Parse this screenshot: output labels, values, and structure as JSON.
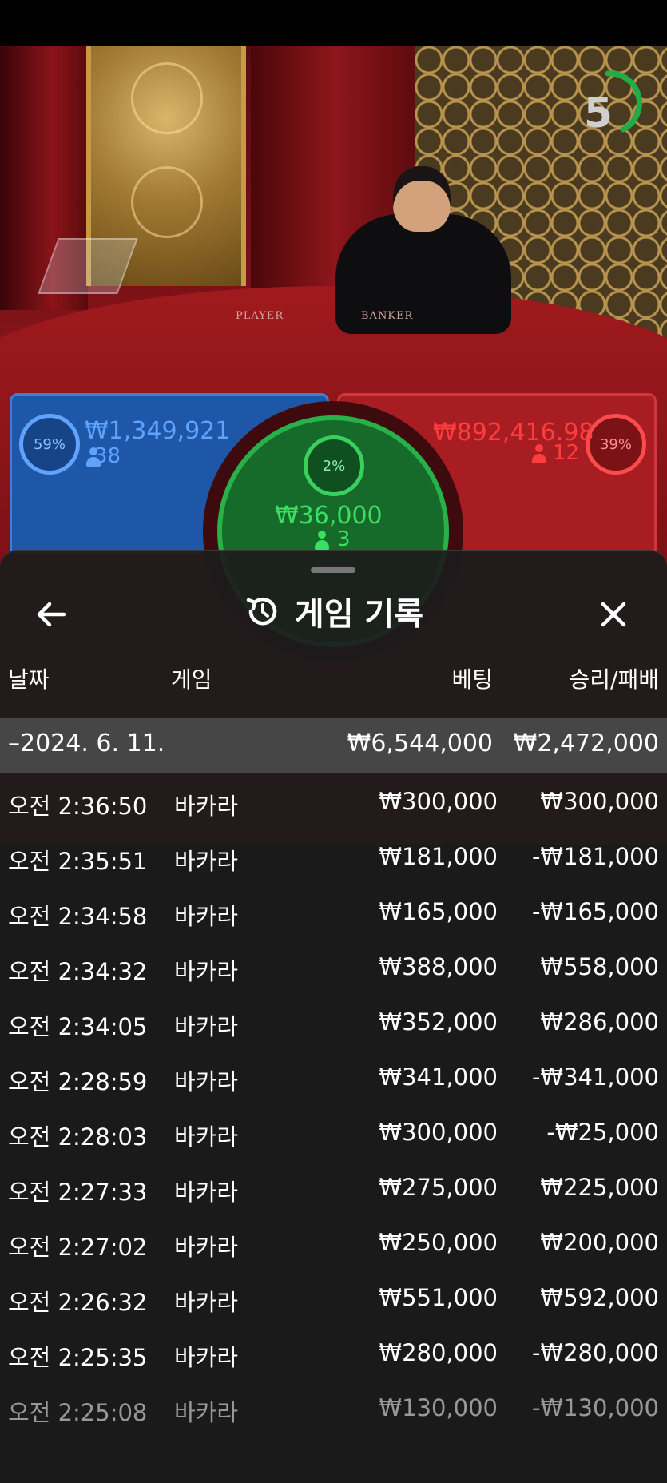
{
  "table": {
    "timer": "5",
    "player_label": "PLAYER",
    "banker_label": "BANKER",
    "player": {
      "percent": "59%",
      "amount": "₩1,349,921",
      "players": "38"
    },
    "banker": {
      "percent": "39%",
      "amount": "₩892,416.98",
      "players": "12"
    },
    "tie": {
      "percent": "2%",
      "amount": "₩36,000",
      "players": "3"
    }
  },
  "sheet": {
    "title": "게임 기록",
    "icons": {
      "back": "arrow-left-icon",
      "history": "history-icon",
      "close": "close-icon"
    },
    "columns": {
      "date": "날짜",
      "game": "게임",
      "bet": "베팅",
      "result": "승리/패배"
    },
    "date_group": {
      "label": "–2024. 6. 11.",
      "bet": "₩6,544,000",
      "result": "₩2,472,000"
    },
    "rows": [
      {
        "time": "오전 2:36:50",
        "game": "바카라",
        "bet": "₩300,000",
        "result": "₩300,000"
      },
      {
        "time": "오전 2:35:51",
        "game": "바카라",
        "bet": "₩181,000",
        "result": "-₩181,000"
      },
      {
        "time": "오전 2:34:58",
        "game": "바카라",
        "bet": "₩165,000",
        "result": "-₩165,000"
      },
      {
        "time": "오전 2:34:32",
        "game": "바카라",
        "bet": "₩388,000",
        "result": "₩558,000"
      },
      {
        "time": "오전 2:34:05",
        "game": "바카라",
        "bet": "₩352,000",
        "result": "₩286,000"
      },
      {
        "time": "오전 2:28:59",
        "game": "바카라",
        "bet": "₩341,000",
        "result": "-₩341,000"
      },
      {
        "time": "오전 2:28:03",
        "game": "바카라",
        "bet": "₩300,000",
        "result": "-₩25,000"
      },
      {
        "time": "오전 2:27:33",
        "game": "바카라",
        "bet": "₩275,000",
        "result": "₩225,000"
      },
      {
        "time": "오전 2:27:02",
        "game": "바카라",
        "bet": "₩250,000",
        "result": "₩200,000"
      },
      {
        "time": "오전 2:26:32",
        "game": "바카라",
        "bet": "₩551,000",
        "result": "₩592,000"
      },
      {
        "time": "오전 2:25:35",
        "game": "바카라",
        "bet": "₩280,000",
        "result": "-₩280,000"
      },
      {
        "time": "오전 2:25:08",
        "game": "바카라",
        "bet": "₩130,000",
        "result": "-₩130,000"
      }
    ]
  },
  "colors": {
    "player_blue": "#5ea3ff",
    "banker_red": "#ff3d3d",
    "tie_green": "#39e062",
    "sheet_bg": "#1c1c1c",
    "date_row_bg": "#464646"
  }
}
